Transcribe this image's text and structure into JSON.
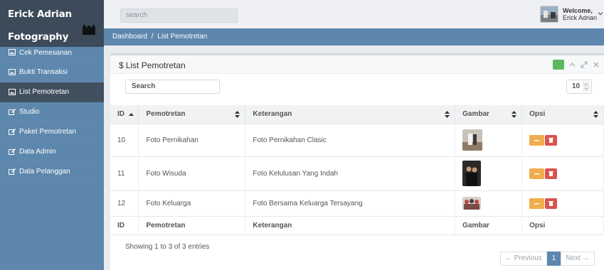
{
  "brand": {
    "line1": "Erick Adrian",
    "line2": "Fotography",
    "icon": "camera-icon"
  },
  "sidebar": {
    "items": [
      {
        "label": "Cek Pemesanan",
        "icon": "image-icon"
      },
      {
        "label": "Bukti Transaksi",
        "icon": "image-icon"
      },
      {
        "label": "List Pemotretan",
        "icon": "image-icon",
        "active": true
      },
      {
        "label": "Studio",
        "icon": "edit-icon"
      },
      {
        "label": "Paket Pemotretan",
        "icon": "edit-icon"
      },
      {
        "label": "Data Admin",
        "icon": "edit-icon"
      },
      {
        "label": "Data Pelanggan",
        "icon": "edit-icon"
      }
    ]
  },
  "header": {
    "search_placeholder": "search",
    "welcome": "Welcome,",
    "user_name": "Erick Adrian"
  },
  "breadcrumb": {
    "home": "Dashboard",
    "separator": "/",
    "current": "List Pemotretan"
  },
  "panel": {
    "title": "List Pemotretan",
    "title_icon": "$",
    "search_placeholder": "Search",
    "page_size": "10"
  },
  "table": {
    "columns": [
      "ID",
      "Pemotretan",
      "Keterangan",
      "Gambar",
      "Opsi"
    ],
    "rows": [
      {
        "id": "10",
        "pemotretan": "Foto Pernikahan",
        "keterangan": "Foto Pernikahan Clasic"
      },
      {
        "id": "11",
        "pemotretan": "Foto Wisuda",
        "keterangan": "Foto Kelulusan Yang Indah"
      },
      {
        "id": "12",
        "pemotretan": "Foto Keluarga",
        "keterangan": "Foto Bersama Keluarga Tersayang"
      }
    ]
  },
  "footer": {
    "info": "Showing 1 to 3 of 3 entries",
    "prev": "← Previous",
    "page": "1",
    "next": "Next →"
  },
  "colors": {
    "sidebar": "#5d87ad",
    "brand": "#3c4a59",
    "active": "#41505e",
    "edit": "#f0ad4e",
    "delete": "#d9534f",
    "add": "#5cb85c"
  }
}
